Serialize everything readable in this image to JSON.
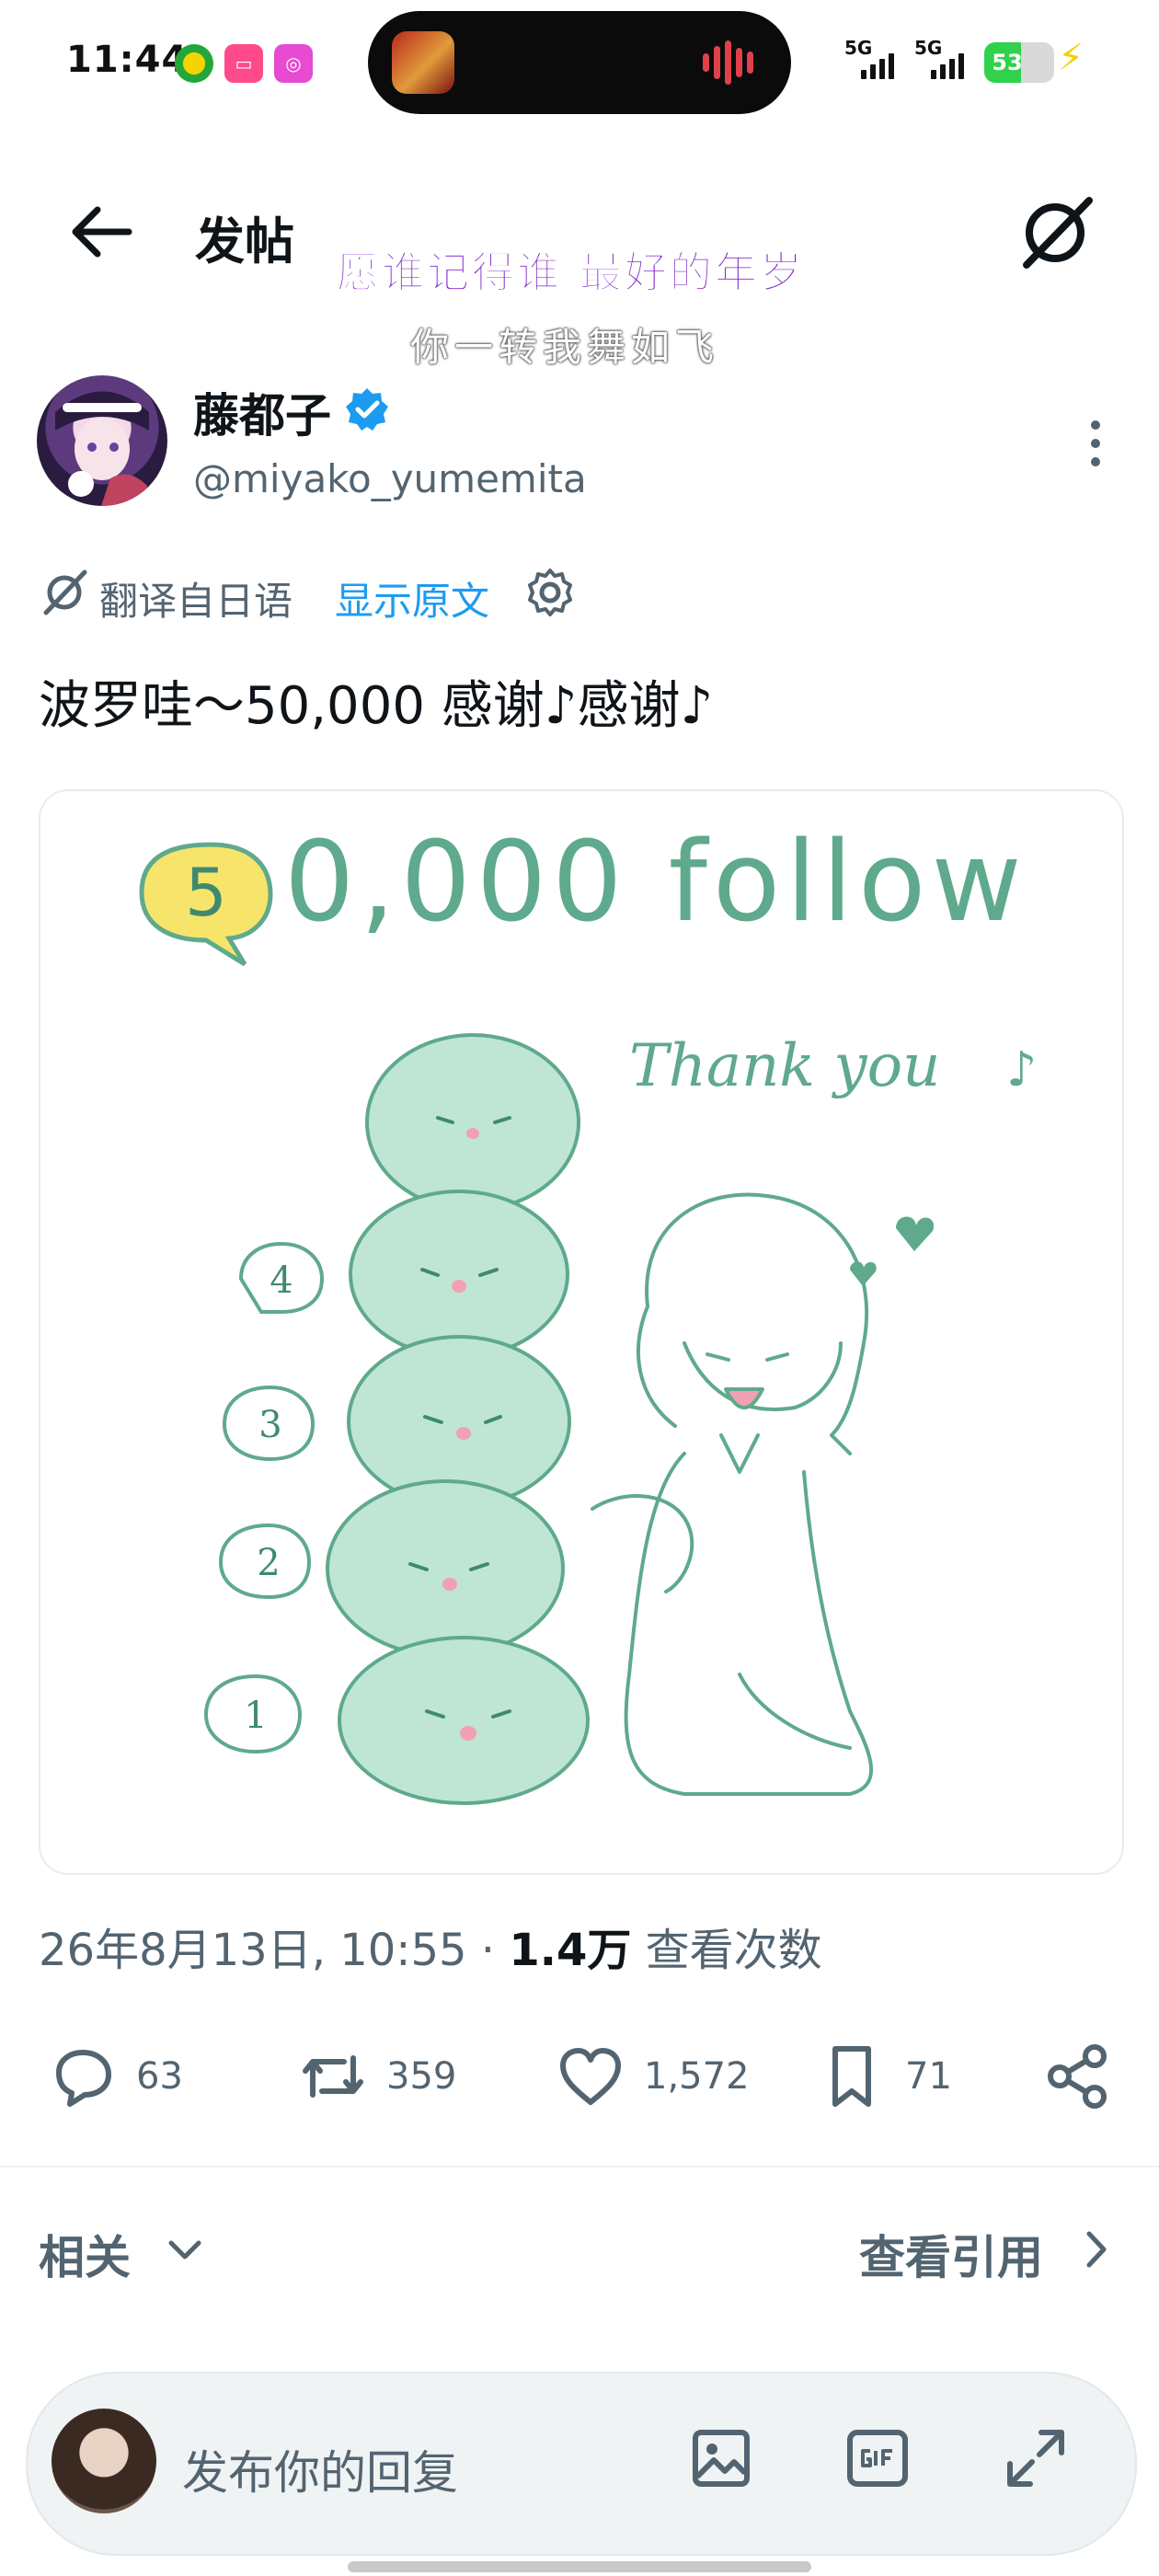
{
  "status": {
    "time": "11:44",
    "battery": "53",
    "battery_level": 0.53,
    "signal1": "5G",
    "signal2": "5G"
  },
  "header": {
    "title": "发帖",
    "back_icon": "arrow-left-icon",
    "grok_icon": "grok-icon"
  },
  "overlay": {
    "line1": "愿谁记得谁 最好的年岁",
    "line2": "你一转我舞如飞"
  },
  "post": {
    "author_name": "藤都子",
    "author_handle": "@miyako_yumemita",
    "translate_label": "翻译自日语",
    "show_original": "显示原文",
    "text": "波罗哇～50,000 感谢♪感谢♪",
    "image": {
      "badge": "5",
      "headline": "0,000 follow",
      "subline": "Thank you",
      "steps": [
        "4",
        "3",
        "2",
        "1"
      ]
    },
    "date": "26年8月13日, 10:55",
    "separator": " · ",
    "views_count": "1.4万",
    "views_label": " 查看次数"
  },
  "actions": {
    "replies": "63",
    "reposts": "359",
    "likes": "1,572",
    "bookmarks": "71"
  },
  "related": {
    "label": "相关",
    "quotes": "查看引用"
  },
  "reply": {
    "placeholder": "发布你的回复"
  },
  "colors": {
    "accent": "#1d9bf0",
    "secondary_text": "#536471",
    "drawing": "#5fa98d",
    "blob_fill": "#bfe6d4"
  }
}
